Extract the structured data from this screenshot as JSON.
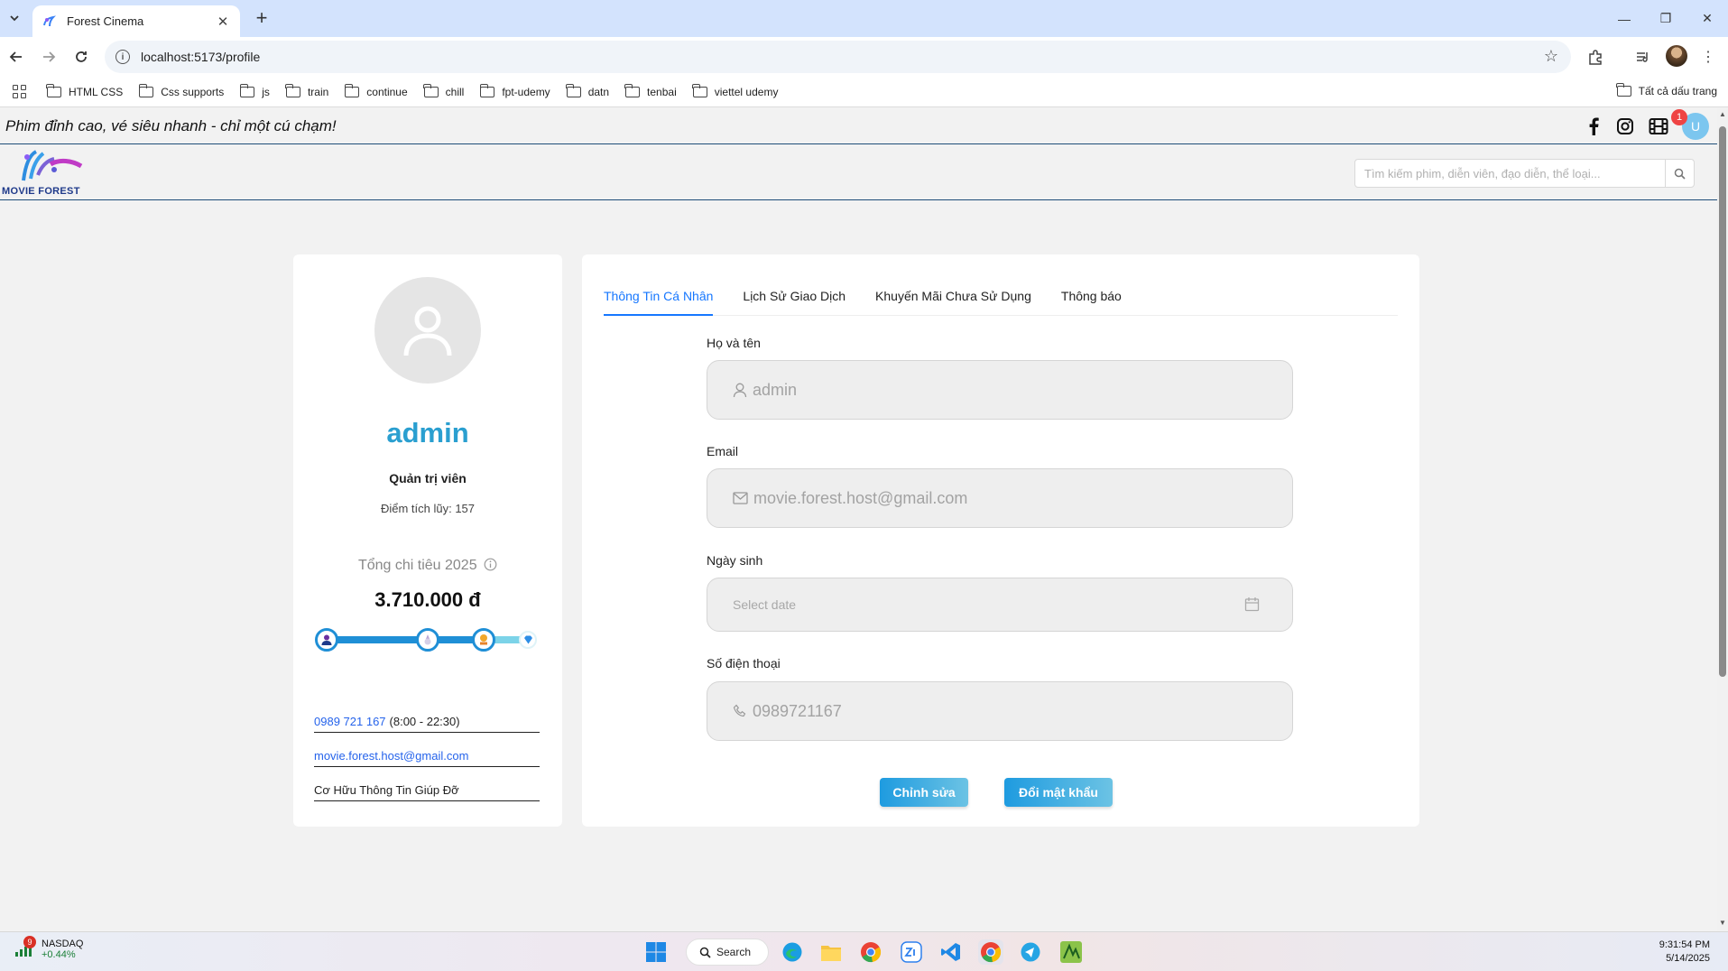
{
  "browser": {
    "tab_title": "Forest Cinema",
    "url": "localhost:5173/profile",
    "bookmarks": [
      "HTML CSS",
      "Css supports",
      "js",
      "train",
      "continue",
      "chill",
      "fpt-udemy",
      "datn",
      "tenbai",
      "viettel udemy"
    ],
    "all_bookmarks": "Tất cả dấu trang"
  },
  "site": {
    "slogan": "Phim đỉnh cao, vé siêu nhanh - chỉ một cú chạm!",
    "logo_text": "MOVIE FOREST",
    "notification_count": "1",
    "user_initial": "U",
    "search_placeholder": "Tìm kiếm phim, diễn viên, đạo diễn, thể loại..."
  },
  "profile": {
    "name": "admin",
    "role": "Quản trị viên",
    "points": "Điểm tích lũy: 157",
    "spend_label": "Tổng chi tiêu 2025",
    "spend_value": "3.710.000 đ",
    "spend_progress": 0.75,
    "phone_link": "0989 721 167",
    "phone_hours": "(8:00 - 22:30)",
    "email_link": "movie.forest.host@gmail.com",
    "help_text": "Cơ Hữu Thông Tin Giúp Đỡ"
  },
  "tabs": [
    {
      "label": "Thông Tin Cá Nhân",
      "active": true
    },
    {
      "label": "Lịch Sử Giao Dịch",
      "active": false
    },
    {
      "label": "Khuyến Mãi Chưa Sử Dụng",
      "active": false
    },
    {
      "label": "Thông báo",
      "active": false
    }
  ],
  "form": {
    "name_label": "Họ và tên",
    "name_value": "admin",
    "email_label": "Email",
    "email_value": "movie.forest.host@gmail.com",
    "dob_label": "Ngày sinh",
    "dob_placeholder": "Select date",
    "phone_label": "Số điện thoại",
    "phone_value": "0989721167",
    "edit_button": "Chỉnh sửa",
    "password_button": "Đổi mật khẩu"
  },
  "taskbar": {
    "ticker_name": "NASDAQ",
    "ticker_change": "+0.44%",
    "ticker_badge": "9",
    "search_label": "Search",
    "time": "9:31:54 PM",
    "date": "5/14/2025"
  },
  "colors": {
    "accent": "#1677ff",
    "brand": "#2a9fd0",
    "button": "#1e9be0"
  }
}
